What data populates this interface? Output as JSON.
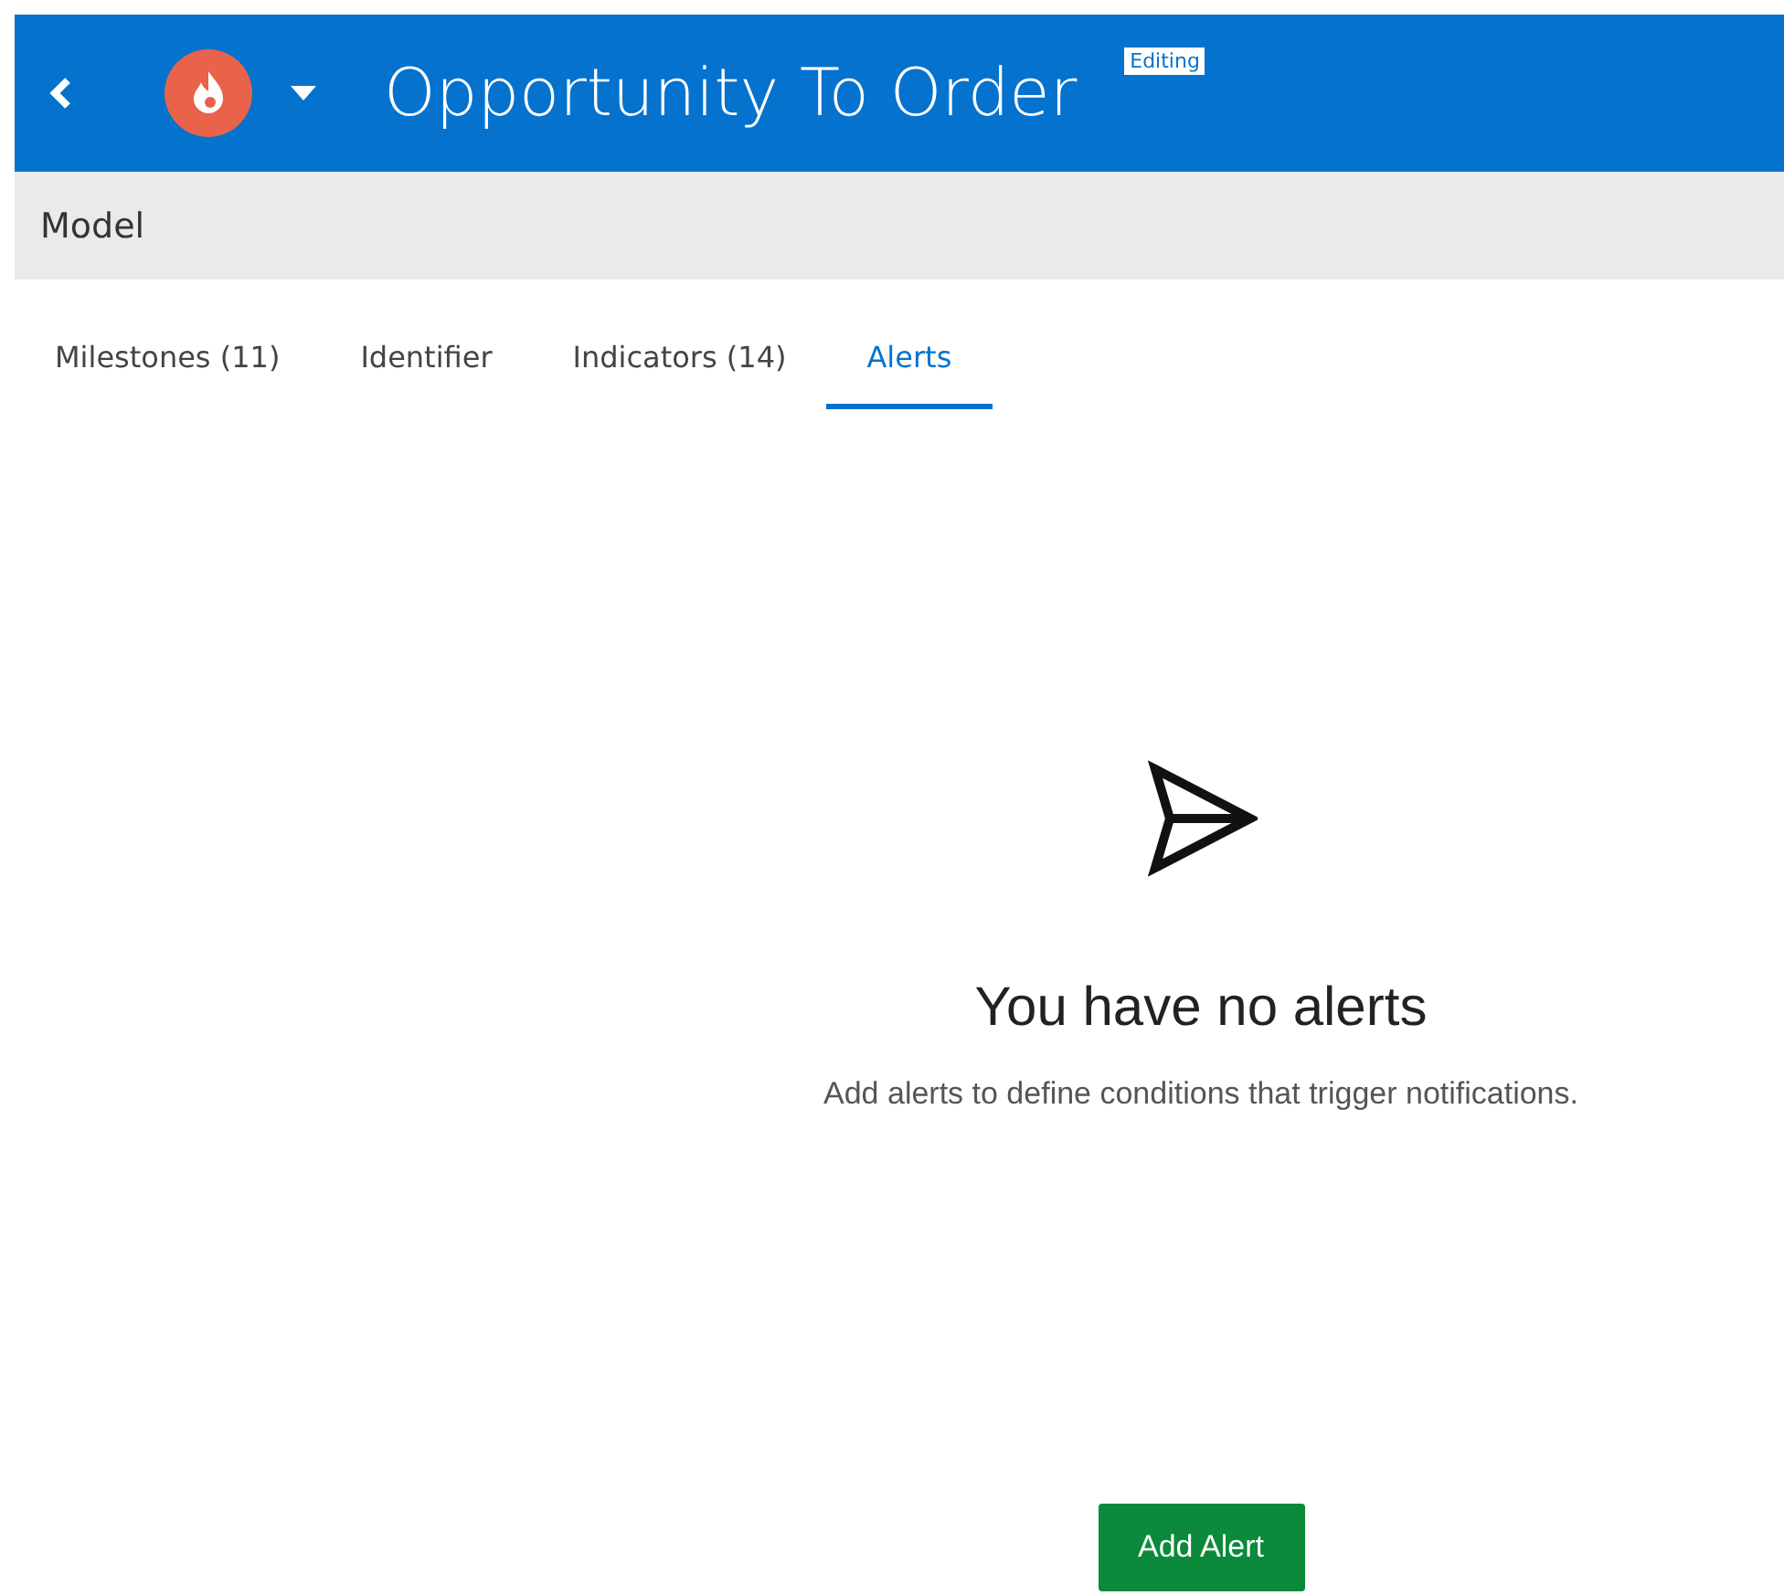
{
  "header": {
    "title": "Opportunity To Order",
    "badge": "Editing"
  },
  "section": {
    "title": "Model"
  },
  "tabs": [
    {
      "label": "Milestones (11)",
      "selected": false
    },
    {
      "label": "Identifier",
      "selected": false
    },
    {
      "label": "Indicators (14)",
      "selected": false
    },
    {
      "label": "Alerts",
      "selected": true
    }
  ],
  "empty_state": {
    "heading": "You have no alerts",
    "message": "Add alerts to define conditions that trigger notifications.",
    "button": "Add Alert"
  }
}
